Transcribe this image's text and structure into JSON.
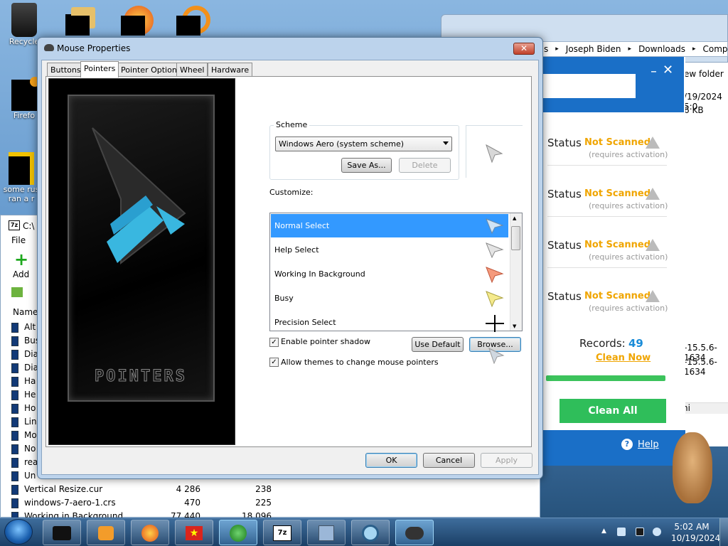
{
  "desktop": {
    "icons": [
      {
        "label": "Recycle"
      },
      {
        "label": "Firefo"
      },
      {
        "label": "some rus"
      },
      {
        "label": "ran a r"
      }
    ]
  },
  "explorer": {
    "breadcrumb": [
      "s",
      "Joseph Biden",
      "Downloads",
      "Compresse"
    ],
    "new_folder": "ew folder",
    "date": "/19/2024 5:0",
    "size": "6 KB",
    "file1": "-15.5.6-1634",
    "file2": "-15.5.6-1634",
    "col_ni": "ni"
  },
  "cleaner": {
    "status_label": "Status",
    "status_value": "Not Scanned",
    "status_note": "(requires activation)",
    "records_label": "Records:",
    "records_value": "49",
    "clean_now": "Clean Now",
    "clean_all": "Clean All",
    "help": "Help",
    "close": "✕",
    "min": "_"
  },
  "sevenzip": {
    "title": "C:\\",
    "menu_file": "File",
    "add_label": "Add",
    "col_name": "Name",
    "rows": [
      {
        "name": "Alt",
        "size": "",
        "packed": ""
      },
      {
        "name": "Bus",
        "size": "",
        "packed": ""
      },
      {
        "name": "Dia",
        "size": "",
        "packed": ""
      },
      {
        "name": "Dia",
        "size": "",
        "packed": ""
      },
      {
        "name": "Ha",
        "size": "",
        "packed": ""
      },
      {
        "name": "He",
        "size": "",
        "packed": ""
      },
      {
        "name": "Ho",
        "size": "",
        "packed": ""
      },
      {
        "name": "Lin",
        "size": "",
        "packed": ""
      },
      {
        "name": "Mo",
        "size": "",
        "packed": ""
      },
      {
        "name": "No",
        "size": "",
        "packed": ""
      },
      {
        "name": "rea",
        "size": "",
        "packed": ""
      },
      {
        "name": "Un",
        "size": "",
        "packed": ""
      },
      {
        "name": "Vertical Resize.cur",
        "size": "4 286",
        "packed": "238"
      },
      {
        "name": "windows-7-aero-1.crs",
        "size": "470",
        "packed": "225"
      },
      {
        "name": "Working in Background",
        "size": "77 440",
        "packed": "18 096"
      }
    ]
  },
  "dialog": {
    "title": "Mouse Properties",
    "close": "✕",
    "tabs": [
      "Buttons",
      "Pointers",
      "Pointer Options",
      "Wheel",
      "Hardware"
    ],
    "selected_tab": "Pointers",
    "preview_text": "POINTERS",
    "scheme_label": "Scheme",
    "scheme_value": "Windows Aero (system scheme)",
    "save_as": "Save As...",
    "delete": "Delete",
    "customize_label": "Customize:",
    "items": [
      {
        "label": "Normal Select",
        "icon": "arrow-cursor-icon"
      },
      {
        "label": "Help Select",
        "icon": "help-cursor-icon"
      },
      {
        "label": "Working In Background",
        "icon": "working-cursor-icon"
      },
      {
        "label": "Busy",
        "icon": "busy-cursor-icon"
      },
      {
        "label": "Precision Select",
        "icon": "crosshair-cursor-icon"
      }
    ],
    "enable_shadow": "Enable pointer shadow",
    "enable_shadow_checked": true,
    "allow_themes": "Allow themes to change mouse pointers",
    "allow_themes_checked": true,
    "use_default": "Use Default",
    "browse": "Browse...",
    "ok": "OK",
    "cancel": "Cancel",
    "apply": "Apply"
  },
  "taskbar": {
    "time": "5:02 AM",
    "date": "10/19/2024"
  },
  "colors": {
    "accent": "#3399ff",
    "cleaner_blue": "#1a6fc7",
    "warning_orange": "#f0a500",
    "green": "#2fbe5a"
  }
}
